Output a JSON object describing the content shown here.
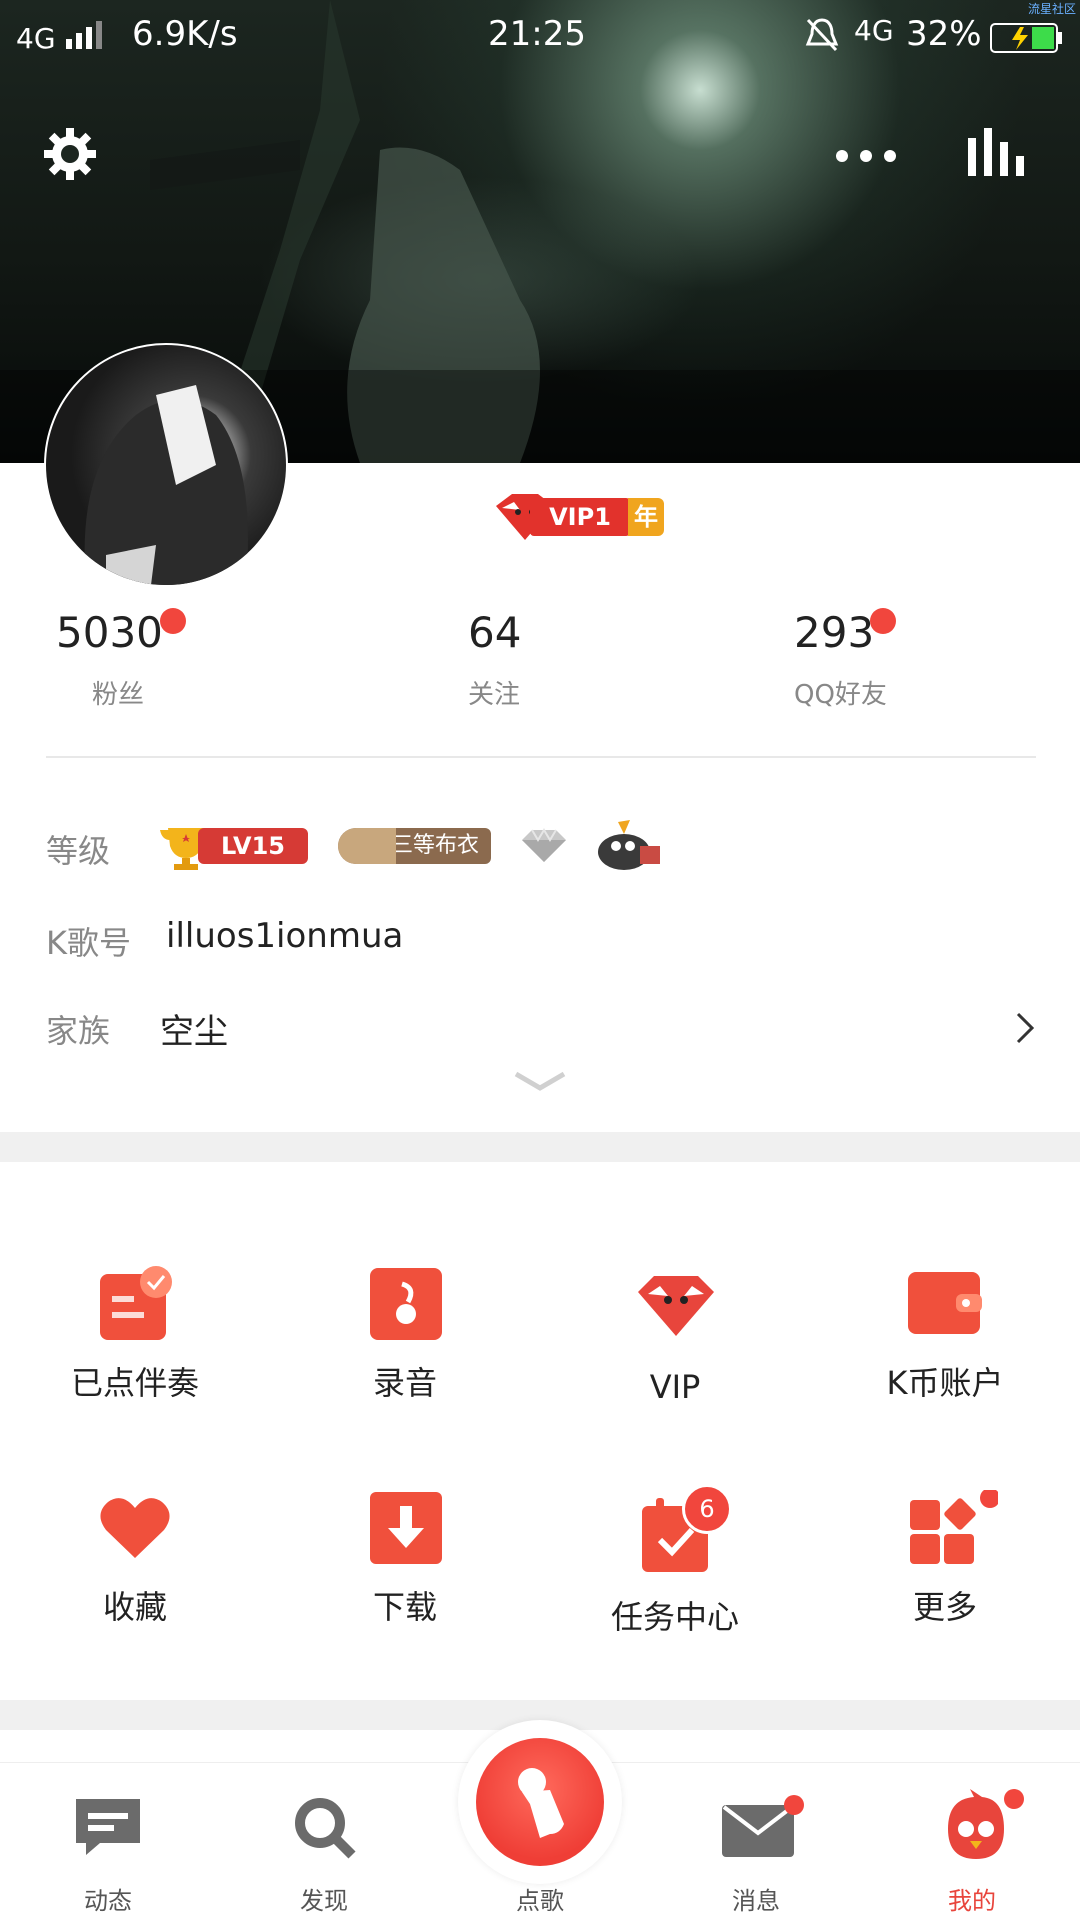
{
  "status_bar": {
    "network": "4G",
    "speed": "6.9K/s",
    "time": "21:25",
    "network_right": "4G",
    "battery": "32%",
    "watermark": "流星社区"
  },
  "profile": {
    "vip_label": "VIP1",
    "vip_year": "年",
    "stats": [
      {
        "value": "5030",
        "label": "粉丝"
      },
      {
        "value": "64",
        "label": "关注"
      },
      {
        "value": "293",
        "label": "QQ好友"
      }
    ],
    "level_label": "等级",
    "level_badge": "LV15",
    "cloth_badge": "三等布衣",
    "kid_label": "K歌号",
    "kid_value": "illuos1ionmua",
    "family_label": "家族",
    "family_value": "空尘"
  },
  "grid": [
    {
      "label": "已点伴奏",
      "icon": "accompaniment-icon"
    },
    {
      "label": "录音",
      "icon": "recording-icon"
    },
    {
      "label": "VIP",
      "icon": "vip-icon"
    },
    {
      "label": "K币账户",
      "icon": "wallet-icon"
    },
    {
      "label": "收藏",
      "icon": "heart-icon"
    },
    {
      "label": "下载",
      "icon": "download-icon"
    },
    {
      "label": "任务中心",
      "icon": "calendar-icon",
      "badge": "6"
    },
    {
      "label": "更多",
      "icon": "more-grid-icon"
    }
  ],
  "tabs": [
    {
      "label": "动态",
      "icon": "feed-icon"
    },
    {
      "label": "发现",
      "icon": "search-icon"
    },
    {
      "label": "点歌",
      "icon": "sing-icon"
    },
    {
      "label": "消息",
      "icon": "mail-icon"
    },
    {
      "label": "我的",
      "icon": "mascot-icon"
    }
  ],
  "colors": {
    "accent": "#e8453c",
    "badge_red": "#f1463d",
    "year_gold": "#f0a51e"
  }
}
